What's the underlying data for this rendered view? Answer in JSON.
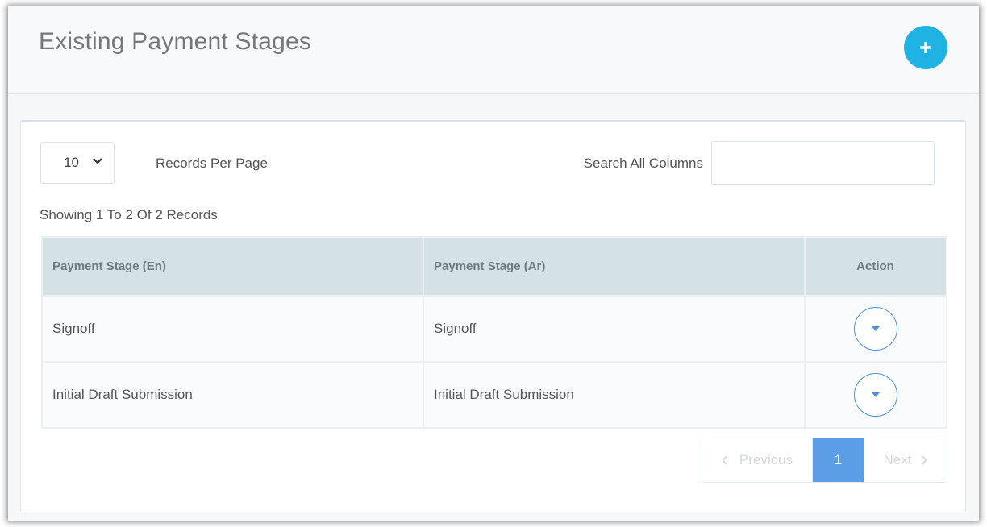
{
  "header": {
    "title": "Existing Payment Stages",
    "add_icon": "plus-icon",
    "accent_color": "#1fb3e3"
  },
  "controls": {
    "length_value": "10",
    "length_options": [
      "10"
    ],
    "length_label": "Records Per Page",
    "search_label": "Search All Columns",
    "search_value": "",
    "search_placeholder": ""
  },
  "info": "Showing 1 To 2 Of 2 Records",
  "table": {
    "columns": [
      "Payment Stage (En)",
      "Payment Stage (Ar)",
      "Action"
    ],
    "rows": [
      {
        "en": "Signoff",
        "ar": "Signoff",
        "action_icon": "caret-down-icon"
      },
      {
        "en": "Initial Draft Submission",
        "ar": "Initial Draft Submission",
        "action_icon": "caret-down-icon"
      }
    ]
  },
  "pagination": {
    "previous": "Previous",
    "current": "1",
    "next": "Next",
    "active_color": "#5b9ee6"
  }
}
